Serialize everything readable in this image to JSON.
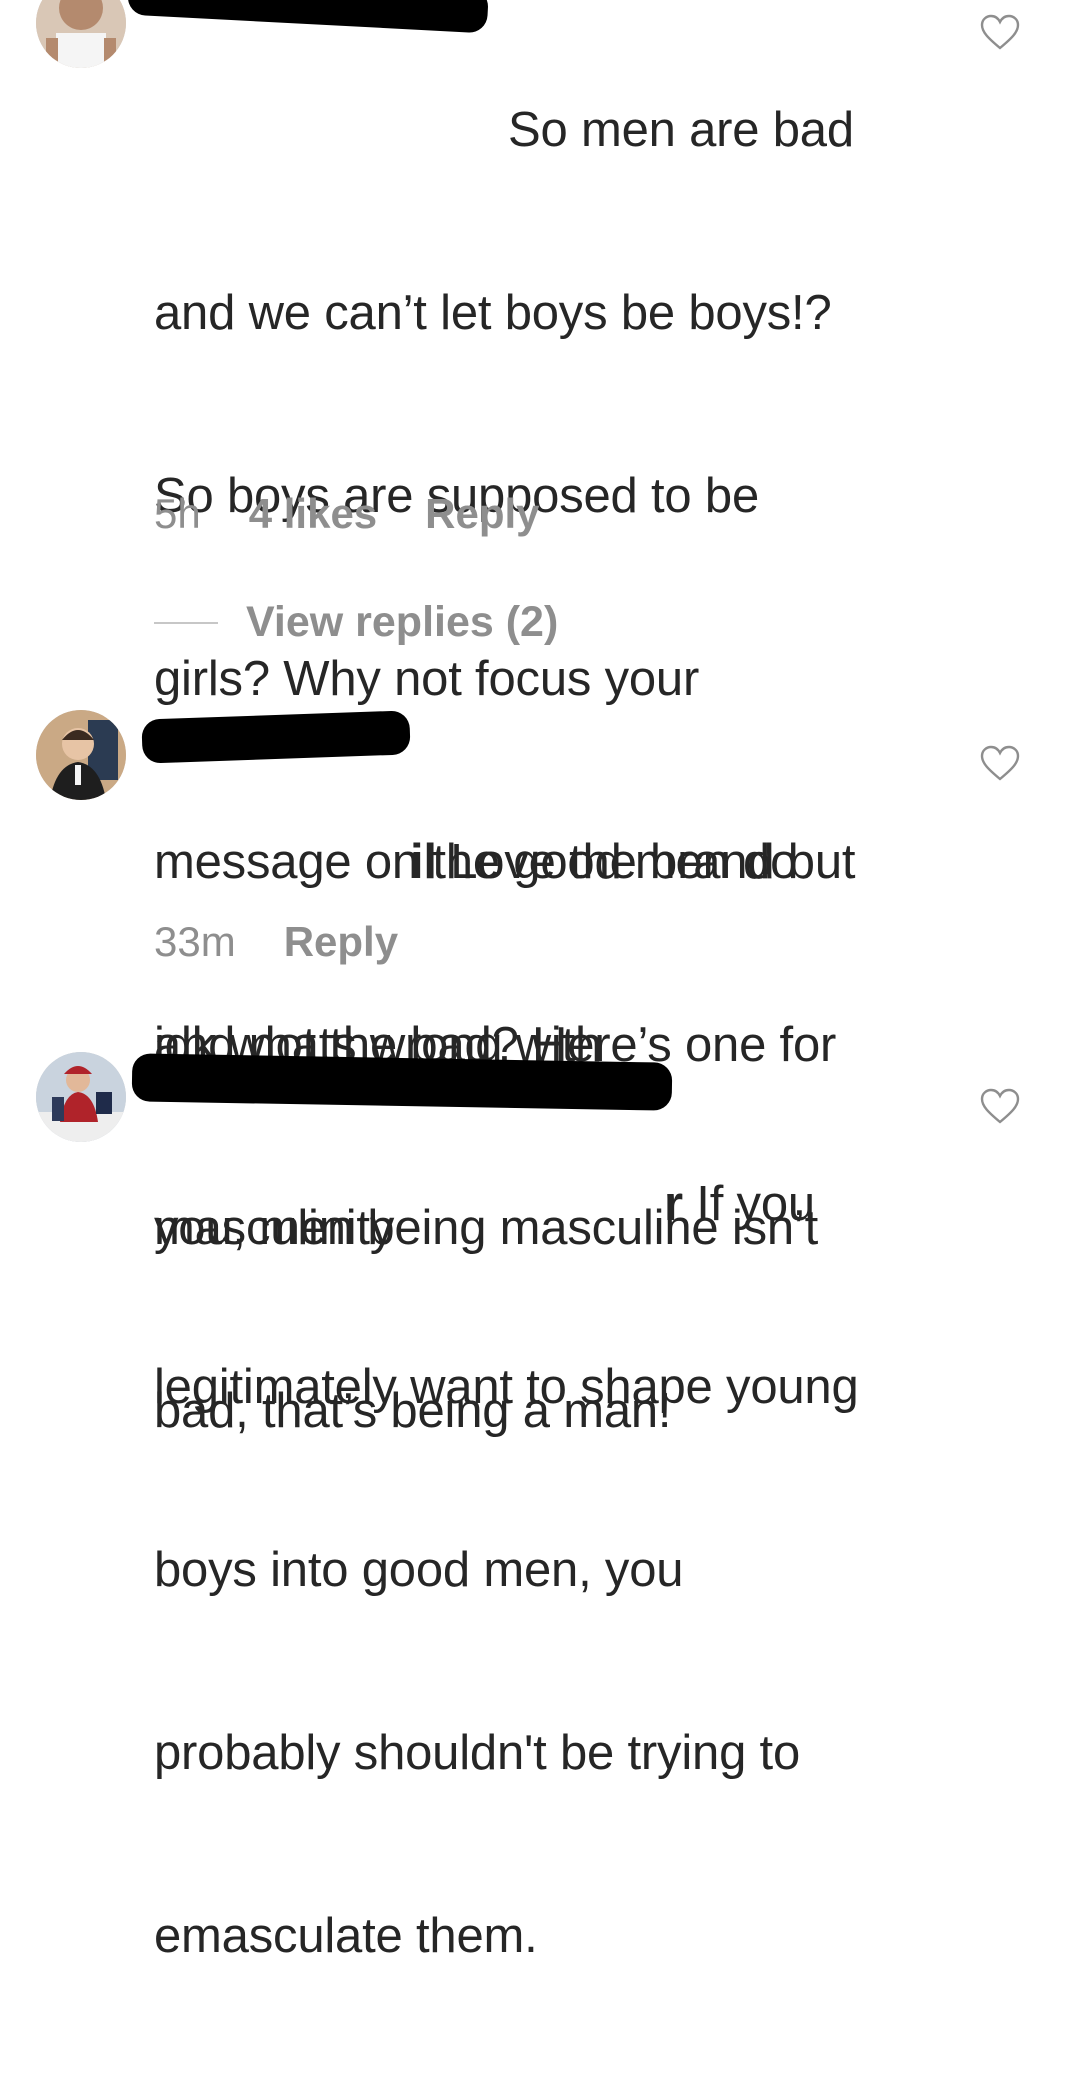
{
  "comments": [
    {
      "text_lines": [
        "So men are bad",
        "and we can’t let boys be boys!?",
        "So boys are supposed to be",
        "girls? Why not focus your",
        "message on the good men do",
        "and not the bad? Here’s one for",
        "you, men being masculine isn’t",
        "bad, that’s being a man!"
      ],
      "time": "5h",
      "likes": "4 likes",
      "reply": "Reply",
      "view_replies": "View replies (2)"
    },
    {
      "username_tail": "il",
      "text_first": "Love the brand but",
      "text_lines": [
        "idk whats wrong with",
        "masculinity"
      ],
      "time": "33m",
      "reply": "Reply"
    },
    {
      "username_tail": "r",
      "text_first": "If you",
      "text_lines": [
        "legitimately want to shape young",
        "boys into good men, you",
        "probably shouldn't be trying to",
        "emasculate them."
      ]
    }
  ],
  "icons": {
    "like": "heart-outline-icon"
  }
}
